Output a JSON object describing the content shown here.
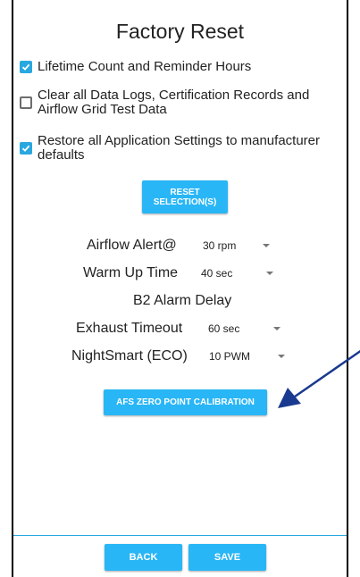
{
  "title": "Factory Reset",
  "options": [
    {
      "label": "Lifetime Count and Reminder Hours",
      "checked": true
    },
    {
      "label": "Clear all Data Logs, Certification Records and Airflow Grid Test Data",
      "checked": false
    },
    {
      "label": "Restore all Application Settings to manufacturer defaults",
      "checked": true
    }
  ],
  "reset_button": {
    "line1": "RESET",
    "line2": "SELECTION(S)"
  },
  "settings": {
    "airflow_alert": {
      "label": "Airflow Alert@",
      "value": "30 rpm"
    },
    "warm_up_time": {
      "label": "Warm Up Time",
      "value": "40 sec"
    },
    "b2_alarm_delay": {
      "label": "B2 Alarm Delay"
    },
    "exhaust_timeout": {
      "label": "Exhaust Timeout",
      "value": "60 sec"
    },
    "nightsmart": {
      "label": "NightSmart (ECO)",
      "value": "10 PWM"
    }
  },
  "afs_button": {
    "label": "AFS ZERO POINT CALIBRATION"
  },
  "footer": {
    "back_label": "BACK",
    "save_label": "SAVE"
  },
  "colors": {
    "accent": "#29b6f6",
    "checkbox": "#29a8e0",
    "arrow": "#1a3a8f"
  },
  "icons": {
    "checked": "checkbox-checked-icon",
    "unchecked": "checkbox-unchecked-icon",
    "caret": "dropdown-caret-icon",
    "arrow": "annotation-arrow-icon"
  }
}
